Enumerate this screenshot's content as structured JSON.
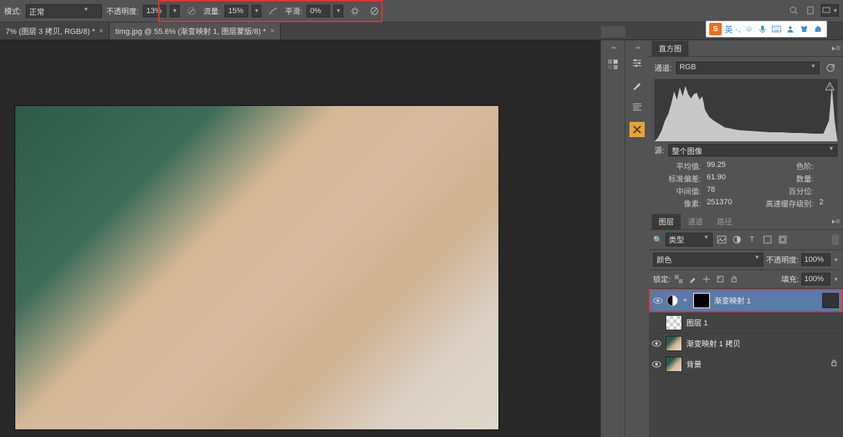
{
  "options_bar": {
    "mode_label": "模式:",
    "mode_value": "正常",
    "opacity_label": "不透明度:",
    "opacity_value": "13%",
    "flow_label": "流量:",
    "flow_value": "15%",
    "smooth_label": "平滑:",
    "smooth_value": "0%"
  },
  "doc_tabs": [
    {
      "title": "7% (图层 3 拷贝, RGB/8) *"
    },
    {
      "title": "timg.jpg @ 55.6% (渐变映射 1, 图层蒙版/8) *"
    }
  ],
  "histogram": {
    "tab_label": "直方图",
    "channel_label": "通道:",
    "channel_value": "RGB",
    "source_label": "源:",
    "source_value": "整个图像",
    "stats": {
      "mean_label": "平均值:",
      "mean_value": "99.25",
      "levels_label": "色阶:",
      "levels_value": "",
      "stddev_label": "标准偏差:",
      "stddev_value": "61.90",
      "count_label": "数量:",
      "count_value": "",
      "median_label": "中间值:",
      "median_value": "78",
      "percentile_label": "百分位:",
      "percentile_value": "",
      "pixels_label": "像素:",
      "pixels_value": "251370",
      "cache_label": "高速缓存级别:",
      "cache_value": "2"
    }
  },
  "layers_panel": {
    "tab_layers": "图层",
    "tab_channels": "通道",
    "tab_paths": "路径",
    "filter_kind": "类型",
    "blend_mode": "颜色",
    "opacity_label": "不透明度:",
    "opacity_value": "100%",
    "lock_label": "锁定:",
    "fill_label": "填充:",
    "fill_value": "100%",
    "layers": [
      {
        "name": "渐变映射 1"
      },
      {
        "name": "图层 1"
      },
      {
        "name": "渐变映射 1 拷贝"
      },
      {
        "name": "背景"
      }
    ]
  },
  "ime": {
    "logo": "S",
    "lang": "英"
  }
}
